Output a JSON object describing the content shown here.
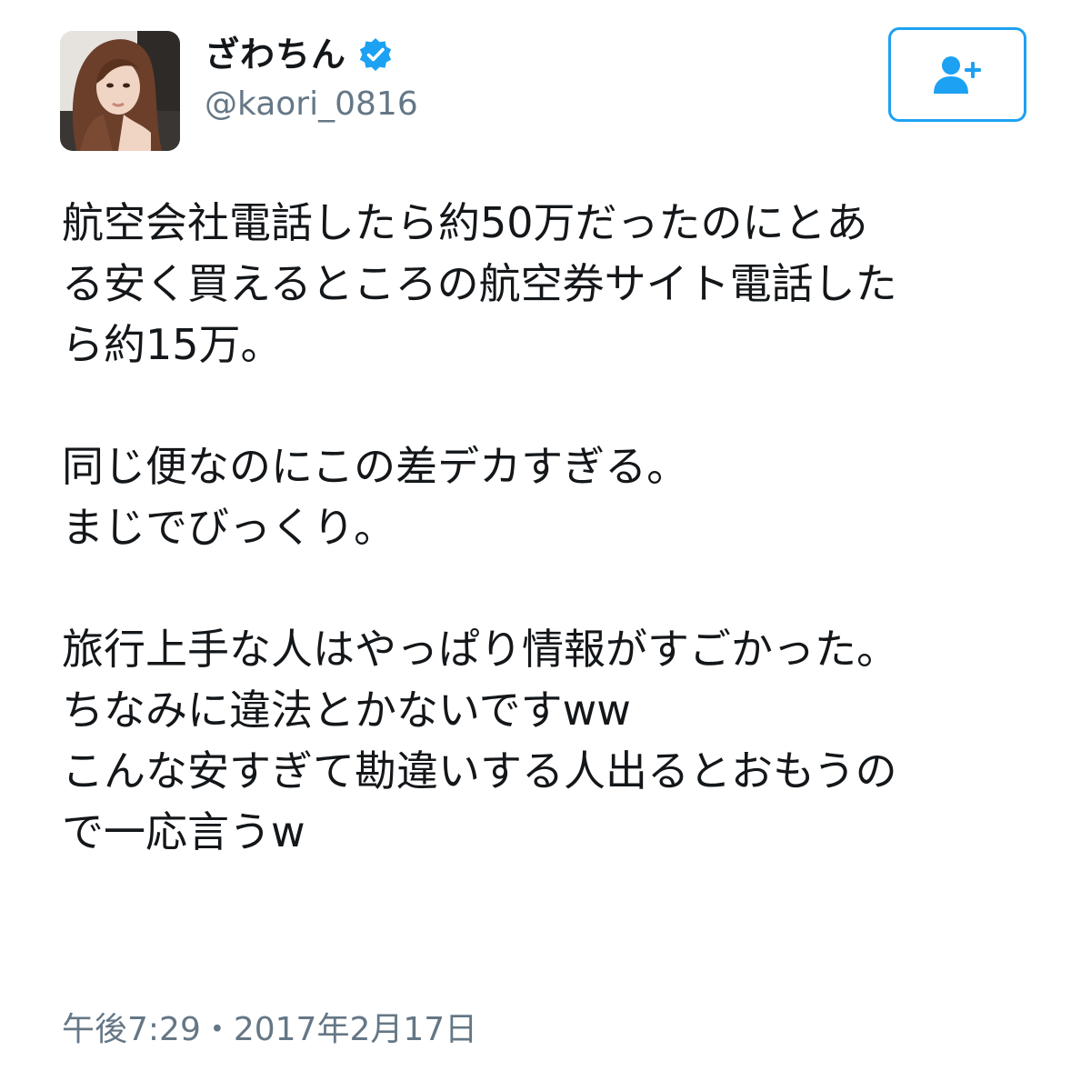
{
  "tweet": {
    "author": {
      "display_name": "ざわちん",
      "handle": "@kaori_0816",
      "verified": true,
      "verified_icon": "verified-badge-icon",
      "avatar_icon": "profile-photo"
    },
    "follow_button": {
      "icon": "add-user-icon"
    },
    "paragraphs": [
      [
        "航空会社電話したら約50万だったのにとあ",
        "る安く買えるところの航空券サイト電話した",
        "ら約15万。"
      ],
      [
        "同じ便なのにこの差デカすぎる。",
        "まじでびっくり。"
      ],
      [
        "旅行上手な人はやっぱり情報がすごかった。",
        "ちなみに違法とかないですww",
        "こんな安すぎて勘違いする人出るとおもうの",
        "で一応言うw"
      ]
    ],
    "timestamp": "午後7:29・2017年2月17日"
  },
  "colors": {
    "accent": "#1da1f2",
    "text": "#14171a",
    "secondary_text": "#657786",
    "background": "#ffffff"
  }
}
